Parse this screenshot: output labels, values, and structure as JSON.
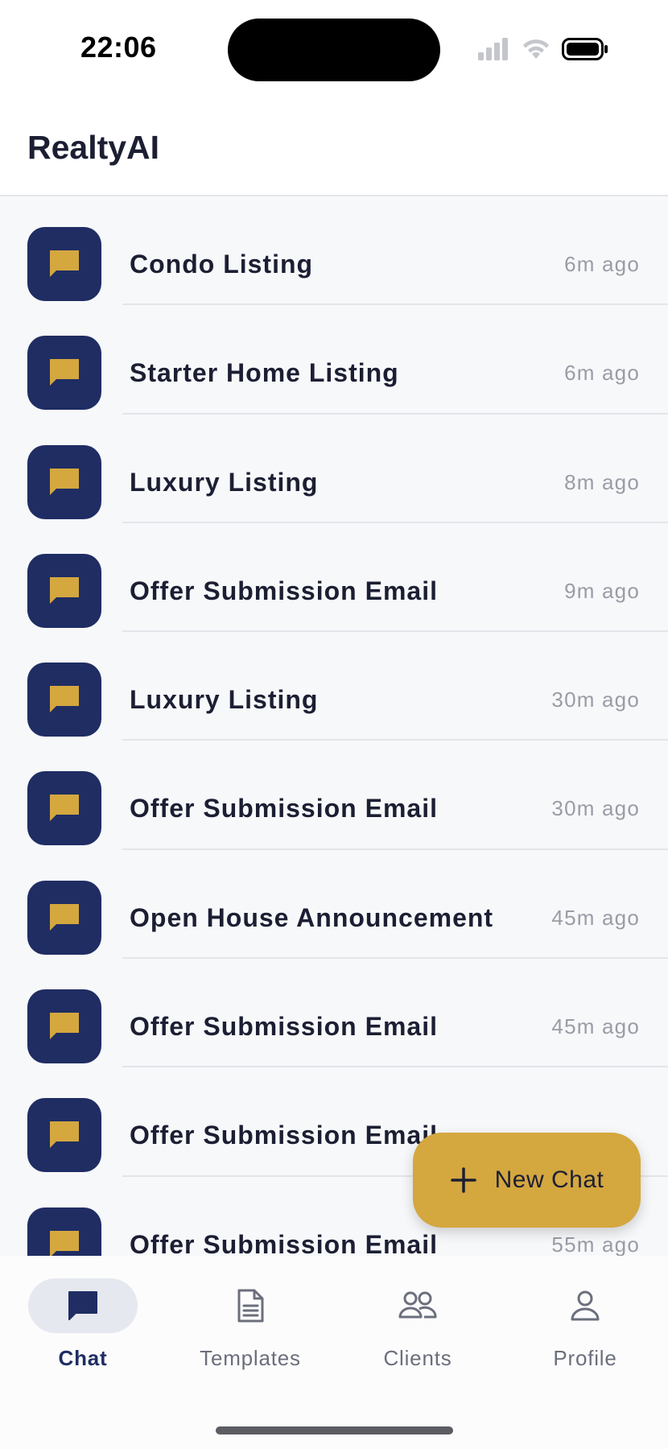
{
  "status_bar": {
    "time": "22:06"
  },
  "header": {
    "title": "RealtyAI"
  },
  "chats": [
    {
      "title": "Condo Listing",
      "time": "6m ago"
    },
    {
      "title": "Starter Home Listing",
      "time": "6m ago"
    },
    {
      "title": "Luxury Listing",
      "time": "8m ago"
    },
    {
      "title": "Offer Submission Email",
      "time": "9m ago"
    },
    {
      "title": "Luxury Listing",
      "time": "30m ago"
    },
    {
      "title": "Offer Submission Email",
      "time": "30m ago"
    },
    {
      "title": "Open House Announcement",
      "time": "45m ago"
    },
    {
      "title": "Offer Submission Email",
      "time": "45m ago"
    },
    {
      "title": "Offer Submission Email",
      "time": ""
    },
    {
      "title": "Offer Submission Email",
      "time": "55m ago"
    }
  ],
  "fab": {
    "label": "New Chat",
    "icon": "plus-icon"
  },
  "tabs": [
    {
      "label": "Chat",
      "icon": "chat-bubble-icon",
      "active": true
    },
    {
      "label": "Templates",
      "icon": "document-icon",
      "active": false
    },
    {
      "label": "Clients",
      "icon": "users-icon",
      "active": false
    },
    {
      "label": "Profile",
      "icon": "person-icon",
      "active": false
    }
  ],
  "colors": {
    "primary_navy": "#1f2d63",
    "accent_gold": "#d4a73f",
    "list_background": "#f7f8fa",
    "muted_text": "#9a9ca6"
  }
}
